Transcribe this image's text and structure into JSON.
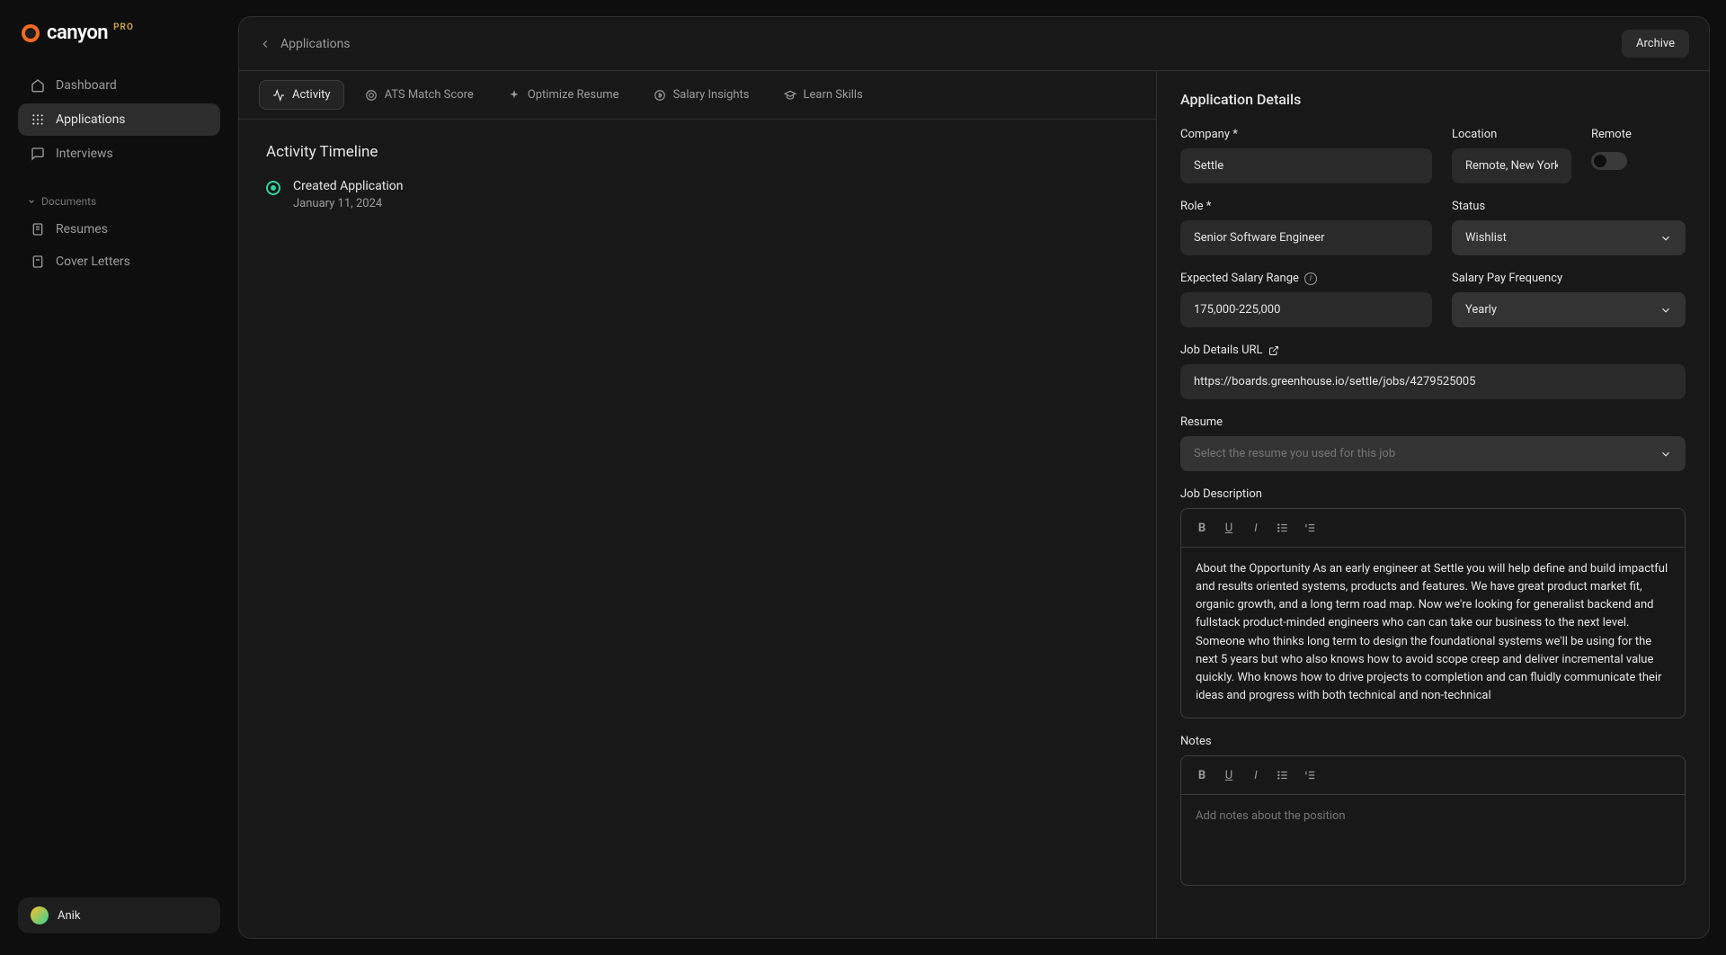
{
  "brand": {
    "name": "canyon",
    "badge": "PRO"
  },
  "sidebar": {
    "items": [
      {
        "label": "Dashboard"
      },
      {
        "label": "Applications"
      },
      {
        "label": "Interviews"
      }
    ],
    "documents_section": "Documents",
    "doc_items": [
      {
        "label": "Resumes"
      },
      {
        "label": "Cover Letters"
      }
    ]
  },
  "user": {
    "name": "Anik"
  },
  "header": {
    "breadcrumb": "Applications",
    "archive_label": "Archive"
  },
  "tabs": [
    {
      "label": "Activity"
    },
    {
      "label": "ATS Match Score"
    },
    {
      "label": "Optimize Resume"
    },
    {
      "label": "Salary Insights"
    },
    {
      "label": "Learn Skills"
    }
  ],
  "activity": {
    "title": "Activity Timeline",
    "items": [
      {
        "title": "Created Application",
        "date": "January 11, 2024"
      }
    ]
  },
  "details": {
    "panel_title": "Application Details",
    "labels": {
      "company": "Company *",
      "location": "Location",
      "remote": "Remote",
      "role": "Role *",
      "status": "Status",
      "expected_salary": "Expected Salary Range",
      "salary_freq": "Salary Pay Frequency",
      "job_url": "Job Details URL",
      "resume": "Resume",
      "job_description": "Job Description",
      "notes": "Notes"
    },
    "values": {
      "company": "Settle",
      "location": "Remote, New York",
      "role": "Senior Software Engineer",
      "status": "Wishlist",
      "expected_salary": "175,000-225,000",
      "salary_freq": "Yearly",
      "job_url": "https://boards.greenhouse.io/settle/jobs/4279525005",
      "resume_placeholder": "Select the resume you used for this job",
      "job_description": "About the Opportunity As an early engineer at Settle you will help define and build impactful and results oriented systems, products and features. We have great product market fit, organic growth, and a long term road map. Now we're looking for generalist backend and fullstack product-minded engineers who can can take our business to the next level. Someone who thinks long term to design the foundational systems we'll be using for the next 5 years but who also knows how to avoid scope creep and deliver incremental value quickly. Who knows how to drive projects to completion and can fluidly communicate their ideas and progress with both technical and non-technical",
      "notes_placeholder": "Add notes about the position"
    }
  }
}
